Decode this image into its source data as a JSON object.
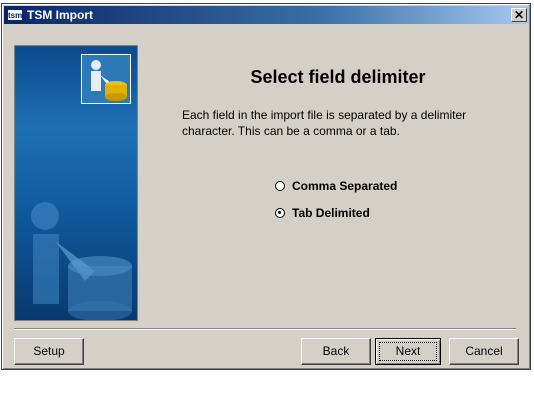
{
  "window": {
    "title": "TSM Import",
    "app_icon_label": "tsm",
    "close_label": "✕"
  },
  "content": {
    "heading": "Select field delimiter",
    "description": "Each field in the import file is separated by a delimiter character. This can be a comma or a tab.",
    "options": [
      {
        "label": "Comma Separated",
        "selected": false
      },
      {
        "label": "Tab Delimited",
        "selected": true
      }
    ]
  },
  "buttons": {
    "setup": "Setup",
    "back": "Back",
    "next": "Next",
    "cancel": "Cancel"
  },
  "colors": {
    "title_bar": "#0a246a",
    "dialog_bg": "#d4d0c8",
    "side_panel": "#1f6fb3"
  }
}
